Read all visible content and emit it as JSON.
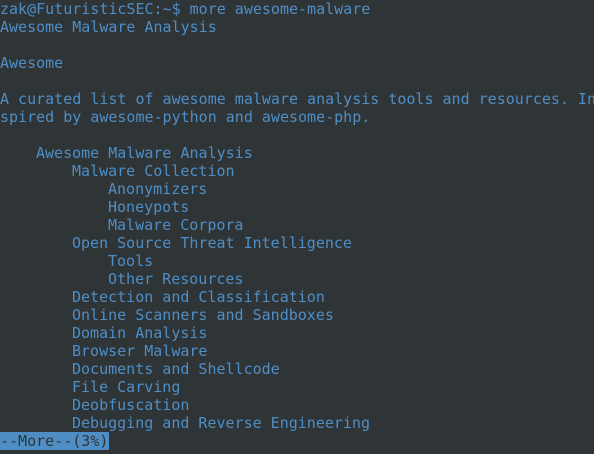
{
  "terminal": {
    "prompt_line": "zak@FuturisticSEC:~$ more awesome-malware",
    "title": "Awesome Malware Analysis",
    "badge": "Awesome",
    "description_line1": "A curated list of awesome malware analysis tools and resources. In",
    "description_line2": "spired by awesome-python and awesome-php.",
    "toc": [
      {
        "indent": 1,
        "label": "Awesome Malware Analysis"
      },
      {
        "indent": 2,
        "label": "Malware Collection"
      },
      {
        "indent": 3,
        "label": "Anonymizers"
      },
      {
        "indent": 3,
        "label": "Honeypots"
      },
      {
        "indent": 3,
        "label": "Malware Corpora"
      },
      {
        "indent": 2,
        "label": "Open Source Threat Intelligence"
      },
      {
        "indent": 3,
        "label": "Tools"
      },
      {
        "indent": 3,
        "label": "Other Resources"
      },
      {
        "indent": 2,
        "label": "Detection and Classification"
      },
      {
        "indent": 2,
        "label": "Online Scanners and Sandboxes"
      },
      {
        "indent": 2,
        "label": "Domain Analysis"
      },
      {
        "indent": 2,
        "label": "Browser Malware"
      },
      {
        "indent": 2,
        "label": "Documents and Shellcode"
      },
      {
        "indent": 2,
        "label": "File Carving"
      },
      {
        "indent": 2,
        "label": "Deobfuscation"
      },
      {
        "indent": 2,
        "label": "Debugging and Reverse Engineering"
      }
    ],
    "more_prompt": "--More--(3%)",
    "colors": {
      "background": "#2f3437",
      "text": "#4f8ec5"
    }
  }
}
